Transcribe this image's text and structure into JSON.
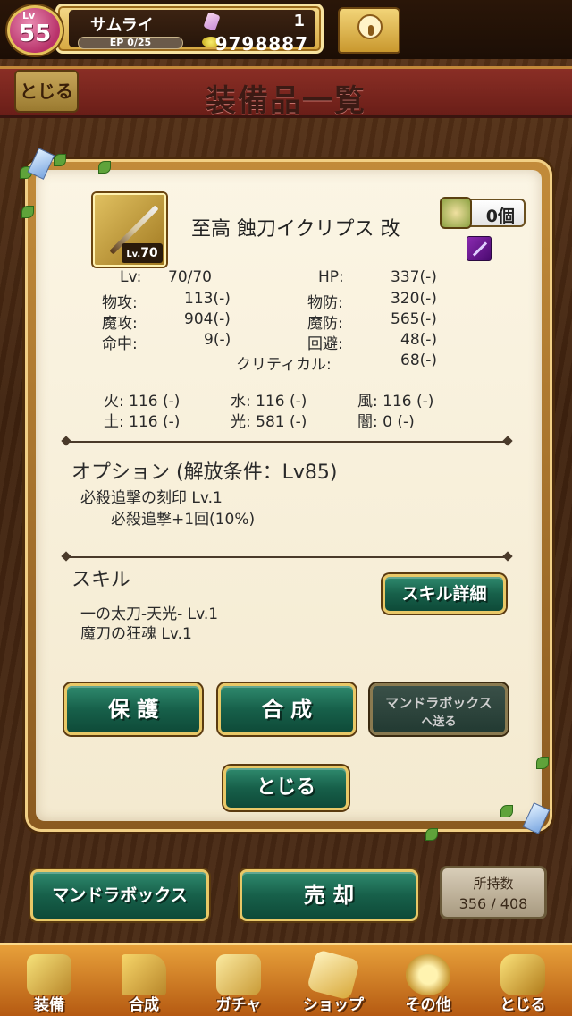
{
  "status": {
    "level_prefix": "Lv",
    "level": "55",
    "player_name": "サムライ",
    "ep_label": "EP 0/25",
    "ep_fill": 0,
    "gems": "1",
    "gold": "9798887"
  },
  "header": {
    "close_label": "とじる",
    "title": "装備品一覧"
  },
  "item": {
    "name": "至高 蝕刀イクリプス 改",
    "icon_level_prefix": "Lv.",
    "icon_level": "70",
    "owned_count": "0個"
  },
  "stats": {
    "lv_label": "Lv:",
    "lv_value": "70/70",
    "hp_label": "HP:",
    "hp_value": "337(-)",
    "patk_label": "物攻:",
    "patk_value": "113(-)",
    "pdef_label": "物防:",
    "pdef_value": "320(-)",
    "matk_label": "魔攻:",
    "matk_value": "904(-)",
    "mdef_label": "魔防:",
    "mdef_value": "565(-)",
    "hit_label": "命中:",
    "hit_value": "9(-)",
    "eva_label": "回避:",
    "eva_value": "48(-)",
    "crit_label": "クリティカル:",
    "crit_value": "68(-)",
    "fire": "火: 116 (-)",
    "water": "水: 116 (-)",
    "wind": "風: 116 (-)",
    "earth": "土: 116 (-)",
    "light": "光: 581 (-)",
    "dark": "闇:    0 (-)"
  },
  "option": {
    "title": "オプション (解放条件：Lv85)",
    "line1": "必殺追撃の刻印 Lv.1",
    "line2": "必殺追撃+1回(10%)"
  },
  "skill": {
    "title": "スキル",
    "line1": "一の太刀-天光-  Lv.1",
    "line2": "魔刀の狂魂  Lv.1",
    "detail_button": "スキル詳細"
  },
  "actions": {
    "protect": "保 護",
    "compose": "合 成",
    "send_line1": "マンドラボックス",
    "send_line2": "へ送る",
    "close": "とじる"
  },
  "under_modal": {
    "mandra_box": "マンドラボックス",
    "sell": "売 却",
    "possession_label": "所持数",
    "possession_value": "356 / 408"
  },
  "nav": [
    {
      "label": "装備",
      "icon": "sword-icon"
    },
    {
      "label": "合成",
      "icon": "hammer-icon"
    },
    {
      "label": "ガチャ",
      "icon": "cards-icon"
    },
    {
      "label": "ショップ",
      "icon": "crystal-icon"
    },
    {
      "label": "その他",
      "icon": "gear-icon"
    },
    {
      "label": "とじる",
      "icon": "gold-icon"
    }
  ],
  "colors": {
    "accent_green": "#17604a",
    "frame_gold": "#e9c867",
    "banner_red": "#8a2e25",
    "nav_orange": "#e7a03a"
  }
}
